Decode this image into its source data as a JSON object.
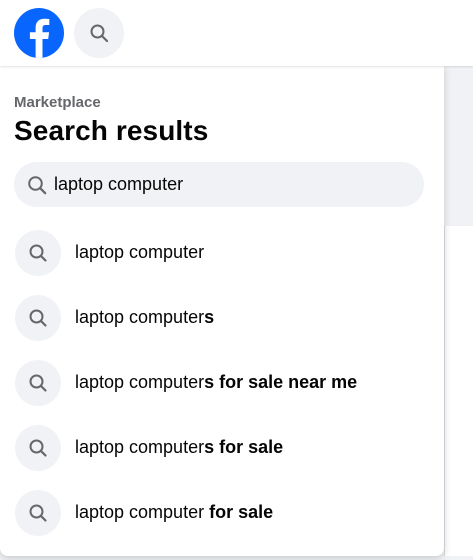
{
  "header": {
    "logo_icon": "facebook-logo-icon",
    "search_icon": "search-icon",
    "brand_color": "#0866ff"
  },
  "panel": {
    "breadcrumb": "Marketplace",
    "title": "Search results",
    "search": {
      "value": "laptop computer",
      "icon": "search-icon"
    },
    "suggestions": [
      {
        "prefix": "laptop computer",
        "suffix": ""
      },
      {
        "prefix": "laptop computer",
        "suffix": "s"
      },
      {
        "prefix": "laptop computer",
        "suffix": "s for sale near me"
      },
      {
        "prefix": "laptop computer",
        "suffix": "s for sale"
      },
      {
        "prefix": "laptop computer",
        "suffix": " for sale"
      }
    ]
  }
}
